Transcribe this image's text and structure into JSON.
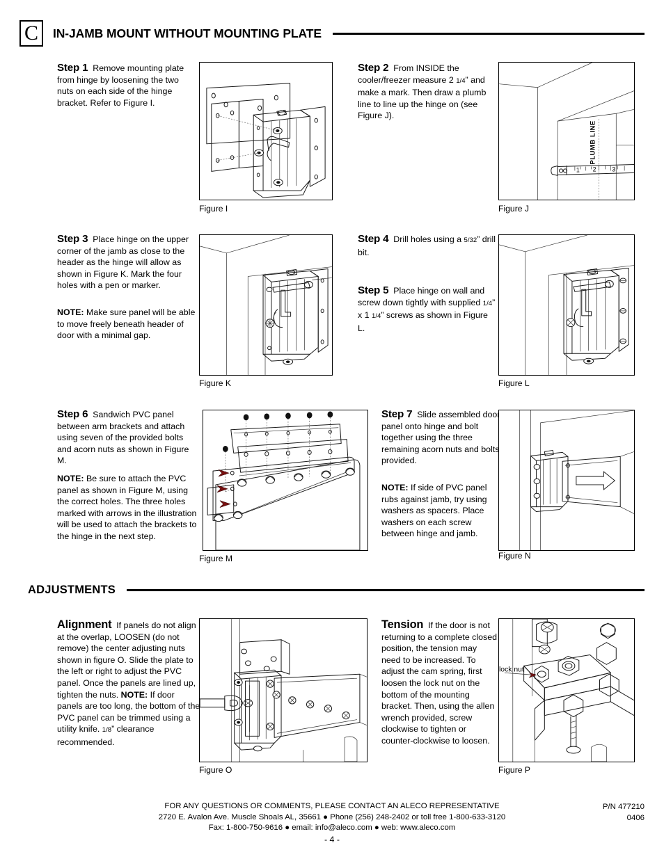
{
  "section": {
    "letter": "C",
    "title": "IN-JAMB MOUNT WITHOUT MOUNTING PLATE"
  },
  "steps": {
    "step1": {
      "name": "Step 1",
      "body": "Remove mounting plate from hinge by loosening the two nuts on each side of the hinge bracket.  Refer to Figure I."
    },
    "step2": {
      "name": "Step 2",
      "body_a": "From INSIDE the cooler/freezer measure 2 ",
      "frac": "1/4",
      "body_b": "” and make a mark.  Then draw a plumb line to line up the hinge on (see Figure J)."
    },
    "step3": {
      "name": "Step 3",
      "body": "Place hinge on the upper corner of the jamb as close to the header as the hinge will allow as shown in Figure K. Mark the four holes with a pen or marker.",
      "note_label": "NOTE:",
      "note": "Make sure panel will be able to move freely beneath header of  door with a minimal gap."
    },
    "step4": {
      "name": "Step 4",
      "body_a": "Drill holes using a ",
      "frac": "5/32",
      "body_b": "” drill bit."
    },
    "step5": {
      "name": "Step 5",
      "body_a": "Place hinge on wall and screw down tightly with supplied ",
      "frac1": "1/4",
      "mid": "” x 1 ",
      "frac2": "1/4",
      "body_b": "” screws as shown in Figure L."
    },
    "step6": {
      "name": "Step 6",
      "body": "Sandwich PVC panel between arm brackets and attach using seven of the provided bolts and acorn nuts as shown in Figure M.",
      "note_label": "NOTE:",
      "note": "Be sure to attach the PVC panel as shown in Figure M, using the correct holes. The three holes marked with arrows in the illustration will be used to attach the brackets to the hinge in the next step."
    },
    "step7": {
      "name": "Step 7",
      "body": "Slide assembled door panel onto hinge and bolt together using the three remaining acorn nuts and bolts provided.",
      "note_label": "NOTE:",
      "note": "If side of PVC panel rubs against jamb, try using washers as spacers.  Place washers on each screw between hinge and jamb."
    }
  },
  "adjustments": {
    "title": "ADJUSTMENTS",
    "alignment": {
      "name": "Alignment",
      "body": "If panels do not align at the overlap, LOOSEN (do not remove) the center adjusting nuts shown in figure O.",
      "body2": "Slide the plate to the left or right to adjust the PVC panel.  Once the panels are lined up, tighten the nuts.",
      "note_label": "NOTE:",
      "note_a": "If door panels are too long, the bottom of the PVC panel can be trimmed using a utility knife.  ",
      "frac": "1/8",
      "note_b": "” clearance recommended."
    },
    "tension": {
      "name": "Tension",
      "body": "If the door is not returning to a complete closed position, the tension may need to be increased.",
      "body2": "To adjust the cam spring, first loosen the lock nut on the bottom of the mounting bracket.  Then, using the allen wrench provided, screw clockwise to tighten or counter-clockwise to loosen."
    }
  },
  "figures": {
    "i": {
      "caption": "Figure I"
    },
    "j": {
      "caption": "Figure J",
      "plumb_label": "PLUMB LINE",
      "tape_marks": [
        "1",
        "2",
        "3"
      ]
    },
    "k": {
      "caption": "Figure K"
    },
    "l": {
      "caption": "Figure L"
    },
    "m": {
      "caption": "Figure M"
    },
    "n": {
      "caption": "Figure N"
    },
    "o": {
      "caption": "Figure O"
    },
    "p": {
      "caption": "Figure P",
      "lock_nut_label": "lock nut"
    }
  },
  "footer": {
    "line1": "FOR ANY QUESTIONS OR COMMENTS, PLEASE CONTACT AN ALECO REPRESENTATIVE",
    "line2": "2720 E. Avalon Ave.  Muscle Shoals AL,  35661 ● Phone (256) 248-2402 or toll free 1-800-633-3120",
    "line3": "Fax:  1-800-750-9616 ● email:  info@aleco.com ● web:  www.aleco.com",
    "part_number": "P/N  477210",
    "date_code": "0406",
    "page": "- 4 -"
  }
}
